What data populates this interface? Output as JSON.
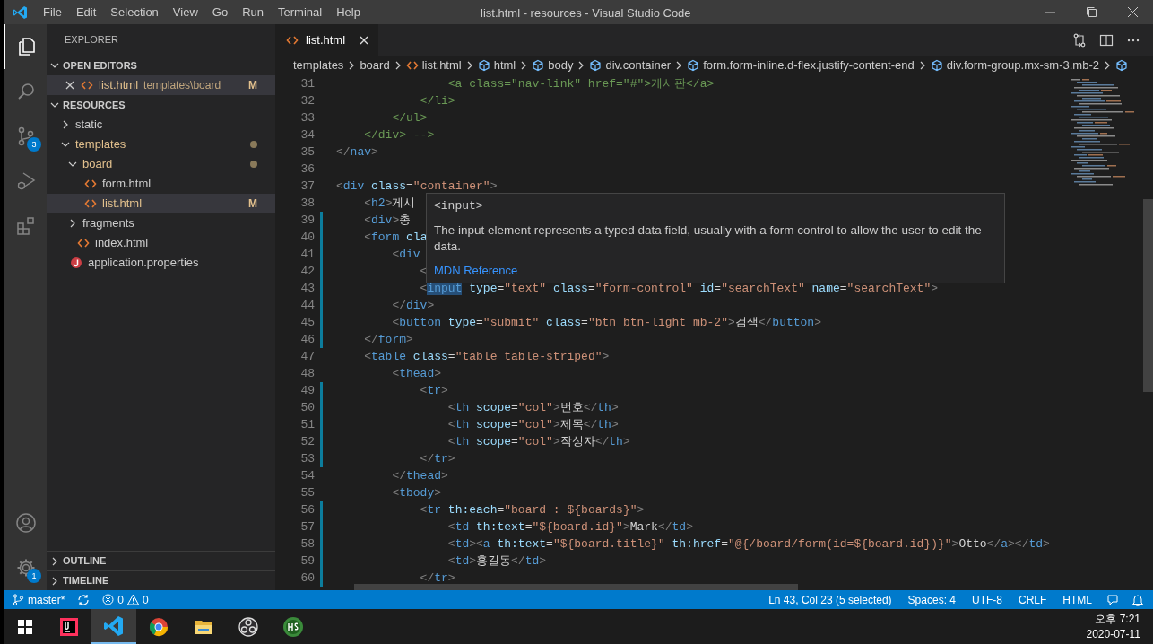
{
  "window": {
    "title": "list.html - resources - Visual Studio Code"
  },
  "menu": [
    "File",
    "Edit",
    "Selection",
    "View",
    "Go",
    "Run",
    "Terminal",
    "Help"
  ],
  "activity_bar": {
    "top": [
      {
        "kind": "files",
        "selected": true
      },
      {
        "kind": "search",
        "selected": false
      },
      {
        "kind": "source-control",
        "selected": false,
        "badge": "3"
      },
      {
        "kind": "debug",
        "selected": false
      },
      {
        "kind": "extensions",
        "selected": false
      }
    ],
    "bottom": [
      {
        "kind": "account"
      },
      {
        "kind": "settings",
        "badge": "1"
      }
    ]
  },
  "sidebar": {
    "title": "EXPLORER",
    "open_editors": {
      "label": "OPEN EDITORS",
      "expanded": true,
      "items": [
        {
          "label": "list.html",
          "path": "templates\\board",
          "badge": "M",
          "kind": "html",
          "modified": true
        }
      ]
    },
    "folder": {
      "label": "RESOURCES",
      "expanded": true,
      "children": [
        {
          "label": "static",
          "kind": "folder",
          "expanded": false,
          "modified": false,
          "selected": false
        },
        {
          "label": "templates",
          "kind": "folder",
          "expanded": true,
          "modified": true,
          "selected": false,
          "children": [
            {
              "label": "board",
              "kind": "folder",
              "expanded": true,
              "modified": true,
              "selected": false,
              "children": [
                {
                  "label": "form.html",
                  "kind": "html",
                  "modified": false,
                  "selected": false
                },
                {
                  "label": "list.html",
                  "kind": "html",
                  "modified": true,
                  "badge": "M",
                  "selected": true
                }
              ]
            },
            {
              "label": "fragments",
              "kind": "folder",
              "expanded": false,
              "modified": false,
              "selected": false
            },
            {
              "label": "index.html",
              "kind": "html",
              "modified": false,
              "selected": false
            }
          ]
        },
        {
          "label": "application.properties",
          "kind": "properties",
          "modified": false,
          "selected": false
        }
      ]
    },
    "sections": [
      {
        "label": "OUTLINE",
        "expanded": false
      },
      {
        "label": "TIMELINE",
        "expanded": false
      }
    ]
  },
  "tabs": [
    {
      "label": "list.html",
      "selected": true
    }
  ],
  "breadcrumb": [
    {
      "label": "templates",
      "kind": "folder"
    },
    {
      "label": "board",
      "kind": "folder"
    },
    {
      "label": "list.html",
      "kind": "html"
    },
    {
      "label": "html",
      "kind": "element"
    },
    {
      "label": "body",
      "kind": "element"
    },
    {
      "label": "div.container",
      "kind": "element"
    },
    {
      "label": "form.form-inline.d-flex.justify-content-end",
      "kind": "element"
    },
    {
      "label": "div.form-group.mx-sm-3.mb-2",
      "kind": "element"
    },
    {
      "kind": "element"
    }
  ],
  "editor": {
    "lines": [
      {
        "number": "31",
        "modified": false,
        "tokens": [
          {
            "kind": "comment",
            "text": "                <a class=\"nav-link\" href=\"#\">게시판</a>"
          }
        ]
      },
      {
        "number": "32",
        "modified": false,
        "tokens": [
          {
            "kind": "comment",
            "text": "            </li>"
          }
        ]
      },
      {
        "number": "33",
        "modified": false,
        "tokens": [
          {
            "kind": "comment",
            "text": "        </ul>"
          }
        ]
      },
      {
        "number": "34",
        "modified": false,
        "tokens": [
          {
            "kind": "comment",
            "text": "    </div> -->"
          }
        ]
      },
      {
        "number": "35",
        "modified": false,
        "tokens": [
          {
            "kind": "punct",
            "text": "</"
          },
          {
            "kind": "tag",
            "text": "nav"
          },
          {
            "kind": "punct",
            "text": ">"
          }
        ]
      },
      {
        "number": "36",
        "modified": false
      },
      {
        "number": "37",
        "modified": false,
        "tokens": [
          {
            "kind": "punct",
            "text": "<"
          },
          {
            "kind": "tag",
            "text": "div"
          },
          {
            "kind": "attr",
            "text": " class"
          },
          {
            "kind": "text",
            "text": "="
          },
          {
            "kind": "str",
            "text": "\"container\""
          },
          {
            "kind": "punct",
            "text": ">"
          }
        ]
      },
      {
        "number": "38",
        "modified": false,
        "tokens": [
          {
            "kind": "punct",
            "text": "    <"
          },
          {
            "kind": "tag",
            "text": "h2"
          },
          {
            "kind": "punct",
            "text": ">"
          },
          {
            "kind": "text",
            "text": "게시"
          }
        ]
      },
      {
        "number": "39",
        "modified": true,
        "tokens": [
          {
            "kind": "punct",
            "text": "    <"
          },
          {
            "kind": "tag",
            "text": "div"
          },
          {
            "kind": "punct",
            "text": ">"
          },
          {
            "kind": "text",
            "text": "총"
          }
        ]
      },
      {
        "number": "40",
        "modified": true,
        "tokens": [
          {
            "kind": "punct",
            "text": "    <"
          },
          {
            "kind": "tag",
            "text": "form"
          },
          {
            "kind": "attr",
            "text": " cla"
          }
        ]
      },
      {
        "number": "41",
        "modified": true,
        "tokens": [
          {
            "kind": "punct",
            "text": "        <"
          },
          {
            "kind": "tag",
            "text": "div"
          }
        ]
      },
      {
        "number": "42",
        "modified": true,
        "tokens": [
          {
            "kind": "punct",
            "text": "            <"
          }
        ]
      },
      {
        "number": "43",
        "modified": true,
        "tokens": [
          {
            "kind": "punct",
            "text": "            <"
          },
          {
            "kind": "tag-selected",
            "text": "input"
          },
          {
            "kind": "attr",
            "text": " type"
          },
          {
            "kind": "text",
            "text": "="
          },
          {
            "kind": "str",
            "text": "\"text\""
          },
          {
            "kind": "attr",
            "text": " class"
          },
          {
            "kind": "text",
            "text": "="
          },
          {
            "kind": "str",
            "text": "\"form-control\""
          },
          {
            "kind": "attr",
            "text": " id"
          },
          {
            "kind": "text",
            "text": "="
          },
          {
            "kind": "str",
            "text": "\"searchText\""
          },
          {
            "kind": "attr",
            "text": " name"
          },
          {
            "kind": "text",
            "text": "="
          },
          {
            "kind": "str",
            "text": "\"searchText\""
          },
          {
            "kind": "punct",
            "text": ">"
          }
        ]
      },
      {
        "number": "44",
        "modified": true,
        "tokens": [
          {
            "kind": "punct",
            "text": "        </"
          },
          {
            "kind": "tag",
            "text": "div"
          },
          {
            "kind": "punct",
            "text": ">"
          }
        ]
      },
      {
        "number": "45",
        "modified": true,
        "tokens": [
          {
            "kind": "punct",
            "text": "        <"
          },
          {
            "kind": "tag",
            "text": "button"
          },
          {
            "kind": "attr",
            "text": " type"
          },
          {
            "kind": "text",
            "text": "="
          },
          {
            "kind": "str",
            "text": "\"submit\""
          },
          {
            "kind": "attr",
            "text": " class"
          },
          {
            "kind": "text",
            "text": "="
          },
          {
            "kind": "str",
            "text": "\"btn btn-light mb-2\""
          },
          {
            "kind": "punct",
            "text": ">"
          },
          {
            "kind": "text",
            "text": "검색"
          },
          {
            "kind": "punct",
            "text": "</"
          },
          {
            "kind": "tag",
            "text": "button"
          },
          {
            "kind": "punct",
            "text": ">"
          }
        ]
      },
      {
        "number": "46",
        "modified": true,
        "tokens": [
          {
            "kind": "punct",
            "text": "    </"
          },
          {
            "kind": "tag",
            "text": "form"
          },
          {
            "kind": "punct",
            "text": ">"
          }
        ]
      },
      {
        "number": "47",
        "modified": false,
        "tokens": [
          {
            "kind": "punct",
            "text": "    <"
          },
          {
            "kind": "tag",
            "text": "table"
          },
          {
            "kind": "attr",
            "text": " class"
          },
          {
            "kind": "text",
            "text": "="
          },
          {
            "kind": "str",
            "text": "\"table table-striped\""
          },
          {
            "kind": "punct",
            "text": ">"
          }
        ]
      },
      {
        "number": "48",
        "modified": false,
        "tokens": [
          {
            "kind": "punct",
            "text": "        <"
          },
          {
            "kind": "tag",
            "text": "thead"
          },
          {
            "kind": "punct",
            "text": ">"
          }
        ]
      },
      {
        "number": "49",
        "modified": true,
        "tokens": [
          {
            "kind": "punct",
            "text": "            <"
          },
          {
            "kind": "tag",
            "text": "tr"
          },
          {
            "kind": "punct",
            "text": ">"
          }
        ]
      },
      {
        "number": "50",
        "modified": true,
        "tokens": [
          {
            "kind": "punct",
            "text": "                <"
          },
          {
            "kind": "tag",
            "text": "th"
          },
          {
            "kind": "attr",
            "text": " scope"
          },
          {
            "kind": "text",
            "text": "="
          },
          {
            "kind": "str",
            "text": "\"col\""
          },
          {
            "kind": "punct",
            "text": ">"
          },
          {
            "kind": "text",
            "text": "번호"
          },
          {
            "kind": "punct",
            "text": "</"
          },
          {
            "kind": "tag",
            "text": "th"
          },
          {
            "kind": "punct",
            "text": ">"
          }
        ]
      },
      {
        "number": "51",
        "modified": true,
        "tokens": [
          {
            "kind": "punct",
            "text": "                <"
          },
          {
            "kind": "tag",
            "text": "th"
          },
          {
            "kind": "attr",
            "text": " scope"
          },
          {
            "kind": "text",
            "text": "="
          },
          {
            "kind": "str",
            "text": "\"col\""
          },
          {
            "kind": "punct",
            "text": ">"
          },
          {
            "kind": "text",
            "text": "제목"
          },
          {
            "kind": "punct",
            "text": "</"
          },
          {
            "kind": "tag",
            "text": "th"
          },
          {
            "kind": "punct",
            "text": ">"
          }
        ]
      },
      {
        "number": "52",
        "modified": true,
        "tokens": [
          {
            "kind": "punct",
            "text": "                <"
          },
          {
            "kind": "tag",
            "text": "th"
          },
          {
            "kind": "attr",
            "text": " scope"
          },
          {
            "kind": "text",
            "text": "="
          },
          {
            "kind": "str",
            "text": "\"col\""
          },
          {
            "kind": "punct",
            "text": ">"
          },
          {
            "kind": "text",
            "text": "작성자"
          },
          {
            "kind": "punct",
            "text": "</"
          },
          {
            "kind": "tag",
            "text": "th"
          },
          {
            "kind": "punct",
            "text": ">"
          }
        ]
      },
      {
        "number": "53",
        "modified": true,
        "tokens": [
          {
            "kind": "punct",
            "text": "            </"
          },
          {
            "kind": "tag",
            "text": "tr"
          },
          {
            "kind": "punct",
            "text": ">"
          }
        ]
      },
      {
        "number": "54",
        "modified": false,
        "tokens": [
          {
            "kind": "punct",
            "text": "        </"
          },
          {
            "kind": "tag",
            "text": "thead"
          },
          {
            "kind": "punct",
            "text": ">"
          }
        ]
      },
      {
        "number": "55",
        "modified": false,
        "tokens": [
          {
            "kind": "punct",
            "text": "        <"
          },
          {
            "kind": "tag",
            "text": "tbody"
          },
          {
            "kind": "punct",
            "text": ">"
          }
        ]
      },
      {
        "number": "56",
        "modified": true,
        "tokens": [
          {
            "kind": "punct",
            "text": "            <"
          },
          {
            "kind": "tag",
            "text": "tr"
          },
          {
            "kind": "attr",
            "text": " th:each"
          },
          {
            "kind": "text",
            "text": "="
          },
          {
            "kind": "str",
            "text": "\"board : ${boards}\""
          },
          {
            "kind": "punct",
            "text": ">"
          }
        ]
      },
      {
        "number": "57",
        "modified": true,
        "tokens": [
          {
            "kind": "punct",
            "text": "                <"
          },
          {
            "kind": "tag",
            "text": "td"
          },
          {
            "kind": "attr",
            "text": " th:text"
          },
          {
            "kind": "text",
            "text": "="
          },
          {
            "kind": "str",
            "text": "\"${board.id}\""
          },
          {
            "kind": "punct",
            "text": ">"
          },
          {
            "kind": "text",
            "text": "Mark"
          },
          {
            "kind": "punct",
            "text": "</"
          },
          {
            "kind": "tag",
            "text": "td"
          },
          {
            "kind": "punct",
            "text": ">"
          }
        ]
      },
      {
        "number": "58",
        "modified": true,
        "tokens": [
          {
            "kind": "punct",
            "text": "                <"
          },
          {
            "kind": "tag",
            "text": "td"
          },
          {
            "kind": "punct",
            "text": "><"
          },
          {
            "kind": "tag",
            "text": "a"
          },
          {
            "kind": "attr",
            "text": " th:text"
          },
          {
            "kind": "text",
            "text": "="
          },
          {
            "kind": "str",
            "text": "\"${board.title}\""
          },
          {
            "kind": "attr",
            "text": " th:href"
          },
          {
            "kind": "text",
            "text": "="
          },
          {
            "kind": "str",
            "text": "\"@{/board/form(id=${board.id})}\""
          },
          {
            "kind": "punct",
            "text": ">"
          },
          {
            "kind": "text",
            "text": "Otto"
          },
          {
            "kind": "punct",
            "text": "</"
          },
          {
            "kind": "tag",
            "text": "a"
          },
          {
            "kind": "punct",
            "text": "></"
          },
          {
            "kind": "tag",
            "text": "td"
          },
          {
            "kind": "punct",
            "text": ">"
          }
        ]
      },
      {
        "number": "59",
        "modified": true,
        "tokens": [
          {
            "kind": "punct",
            "text": "                <"
          },
          {
            "kind": "tag",
            "text": "td"
          },
          {
            "kind": "punct",
            "text": ">"
          },
          {
            "kind": "text",
            "text": "홍길동"
          },
          {
            "kind": "punct",
            "text": "</"
          },
          {
            "kind": "tag",
            "text": "td"
          },
          {
            "kind": "punct",
            "text": ">"
          }
        ]
      },
      {
        "number": "60",
        "modified": true,
        "tokens": [
          {
            "kind": "punct",
            "text": "            </"
          },
          {
            "kind": "tag",
            "text": "tr"
          },
          {
            "kind": "punct",
            "text": ">"
          }
        ]
      }
    ],
    "hover": {
      "title": "<input>",
      "description": "The input element represents a typed data field, usually with a form control to allow the user to edit the data.",
      "link": "MDN Reference"
    }
  },
  "status_bar": {
    "branch": "master*",
    "errors": "0",
    "warnings": "0",
    "right": [
      "Ln 43, Col 23 (5 selected)",
      "Spaces: 4",
      "UTF-8",
      "CRLF",
      "HTML"
    ]
  },
  "taskbar": {
    "apps": [
      {
        "kind": "intellij",
        "selected": false
      },
      {
        "kind": "vscode",
        "selected": true
      },
      {
        "kind": "chrome",
        "selected": false
      },
      {
        "kind": "files",
        "selected": false
      },
      {
        "kind": "obs",
        "selected": false
      },
      {
        "kind": "hs",
        "selected": false
      }
    ],
    "time": "오후 7:21",
    "date": "2020-07-11"
  }
}
